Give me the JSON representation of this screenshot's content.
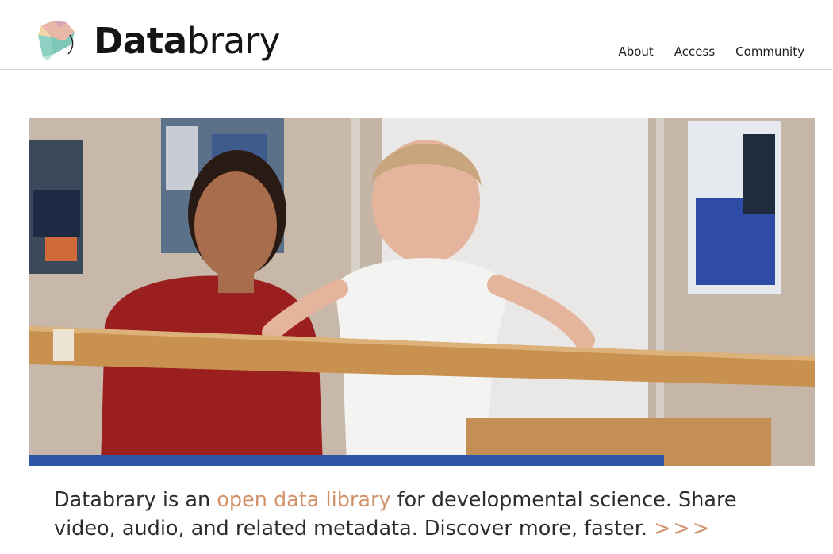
{
  "brand": {
    "name_bold": "Data",
    "name_rest": "brary"
  },
  "nav": {
    "items": [
      {
        "label": "About"
      },
      {
        "label": "Access"
      },
      {
        "label": "Community"
      }
    ]
  },
  "hero": {
    "image_icon": "photo-infant-walking-with-caregiver"
  },
  "tagline": {
    "pre": "Databrary is an ",
    "link": "open data library",
    "post": " for developmental science. Share video, audio, and related metadata. Discover more, faster. ",
    "more": ">>>"
  },
  "colors": {
    "accent": "#d2936a",
    "text": "#2d2d2d",
    "divider": "#d6d6d6"
  }
}
